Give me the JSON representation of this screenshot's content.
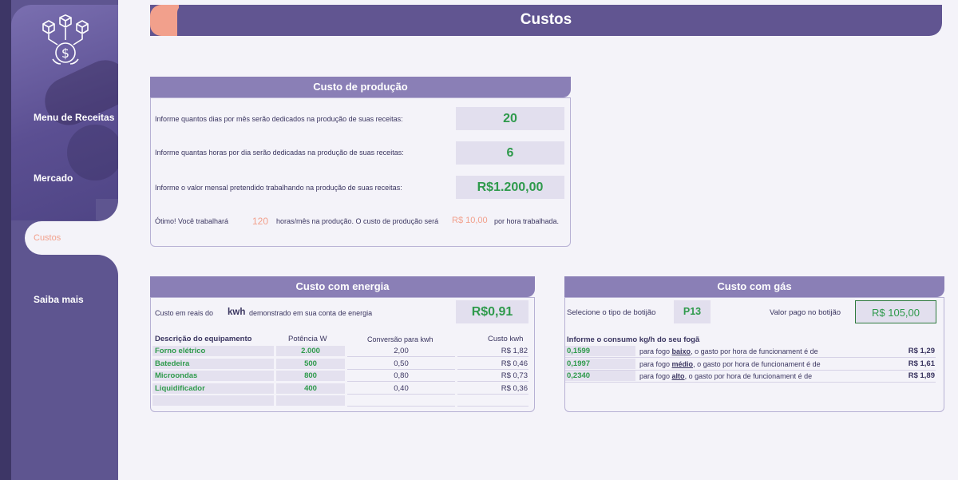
{
  "sidebar": {
    "items": [
      {
        "label": "Menu de Receitas"
      },
      {
        "label": "Mercado"
      },
      {
        "label": "Custos"
      },
      {
        "label": "Saiba mais"
      }
    ],
    "active_color": "#f2a08c"
  },
  "header": {
    "title": "Custos"
  },
  "producao": {
    "title": "Custo de produção",
    "q_dias": "Informe quantos dias por mês serão dedicados na produção de suas receitas:",
    "v_dias": "20",
    "q_horas": "Informe quantas horas por dia serão dedicadas na produção de suas receitas:",
    "v_horas": "6",
    "q_valor": "Informe o valor mensal pretendido trabalhando na produção de suas receitas:",
    "v_valor": "R$1.200,00",
    "res_a": "Ótimo! Você trabalhará",
    "res_horas": "120",
    "res_b": "horas/mês na produção. O custo de produção será",
    "res_custo": "R$ 10,00",
    "res_c": "por hora trabalhada."
  },
  "energia": {
    "title": "Custo com energia",
    "kwh_label_a": "Custo em reais  do",
    "kwh_label_b": "kwh",
    "kwh_label_c": "demonstrado em sua conta de energia",
    "kwh_value": "R$0,91",
    "columns": [
      "Descrição do equipamento",
      "Potência W",
      "Conversão para kwh",
      "Custo kwh"
    ],
    "rows": [
      {
        "desc": "Forno elétrico",
        "pot": "2.000",
        "conv": "2,00",
        "custo": "R$ 1,82"
      },
      {
        "desc": "Batedeira",
        "pot": "500",
        "conv": "0,50",
        "custo": "R$ 0,46"
      },
      {
        "desc": "Microondas",
        "pot": "800",
        "conv": "0,80",
        "custo": "R$ 0,73"
      },
      {
        "desc": "Liquidificador",
        "pot": "400",
        "conv": "0,40",
        "custo": "R$ 0,36"
      }
    ]
  },
  "gas": {
    "title": "Custo com gás",
    "tipo_label": "Selecione o tipo de botijão",
    "tipo_value": "P13",
    "valor_label": "Valor pago no botijão",
    "valor_value": "R$ 105,00",
    "consumo_label": "Informe o consumo kg/h do seu fogã",
    "rows": [
      {
        "kg": "0,1599",
        "pre": "para fogo",
        "fogo": "baixo",
        "post": ", o gasto por hora de funcionament é de",
        "valor": "R$ 1,29"
      },
      {
        "kg": "0,1997",
        "pre": "para fogo",
        "fogo": "médio",
        "post": ", o gasto por hora de funcionament é de",
        "valor": "R$ 1,61"
      },
      {
        "kg": "0,2340",
        "pre": "para fogo",
        "fogo": "alto",
        "post": ", o gasto por hora de funcionament é de",
        "valor": "R$ 1,89"
      }
    ]
  }
}
